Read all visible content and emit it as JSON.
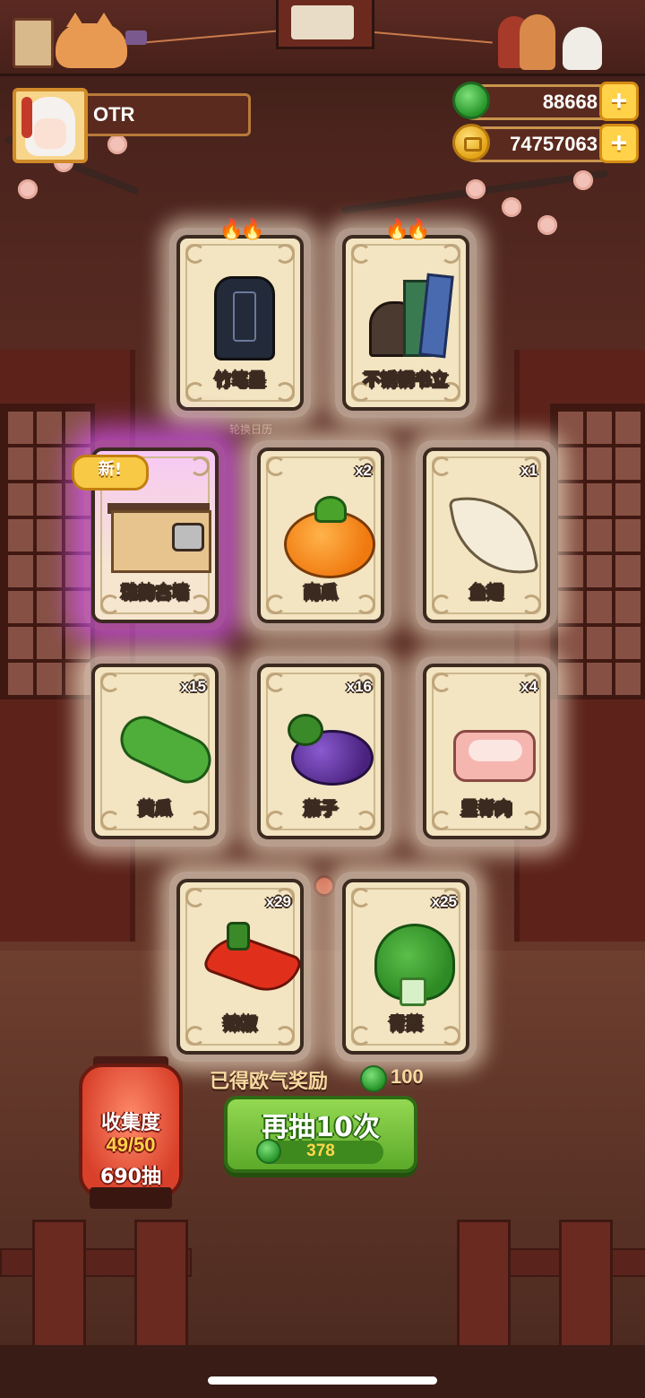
{
  "player": {
    "name": "OTR"
  },
  "currency": {
    "jade": "88668",
    "coins": "74757063"
  },
  "wheel_label": "轮换日历",
  "cards": [
    {
      "name": "竹笔墨",
      "qty": "",
      "art": "ink-icon",
      "flames": "🔥🔥",
      "badge": ""
    },
    {
      "name": "不锈钢书立",
      "qty": "",
      "art": "bookend-icon",
      "flames": "🔥🔥",
      "badge": ""
    },
    {
      "name": "雅韵古墙",
      "qty": "",
      "art": "ancient-wall-icon",
      "flames": "",
      "badge": "新!"
    },
    {
      "name": "南瓜",
      "qty": "x2",
      "art": "pumpkin-icon",
      "flames": "",
      "badge": ""
    },
    {
      "name": "鱼翅",
      "qty": "x1",
      "art": "shark-fin-icon",
      "flames": "",
      "badge": ""
    },
    {
      "name": "黄瓜",
      "qty": "x15",
      "art": "cucumber-icon",
      "flames": "",
      "badge": ""
    },
    {
      "name": "茄子",
      "qty": "x16",
      "art": "eggplant-icon",
      "flames": "",
      "badge": ""
    },
    {
      "name": "里脊肉",
      "qty": "x4",
      "art": "tenderloin-icon",
      "flames": "",
      "badge": ""
    },
    {
      "name": "辣椒",
      "qty": "x29",
      "art": "chili-pepper-icon",
      "flames": "",
      "badge": ""
    },
    {
      "name": "青菜",
      "qty": "x25",
      "art": "bok-choy-icon",
      "flames": "",
      "badge": ""
    }
  ],
  "reward": {
    "label": "已得欧气奖励",
    "value": "100"
  },
  "draw_button": {
    "label": "再抽10次",
    "cost": "378"
  },
  "collection": {
    "label": "收集度",
    "progress": "49/50",
    "draws": "690抽"
  },
  "colors": {
    "jade": "#27962a",
    "coin": "#e3a315",
    "draw_button": "#5caa2a",
    "rare_glow": "#dc5aff"
  }
}
